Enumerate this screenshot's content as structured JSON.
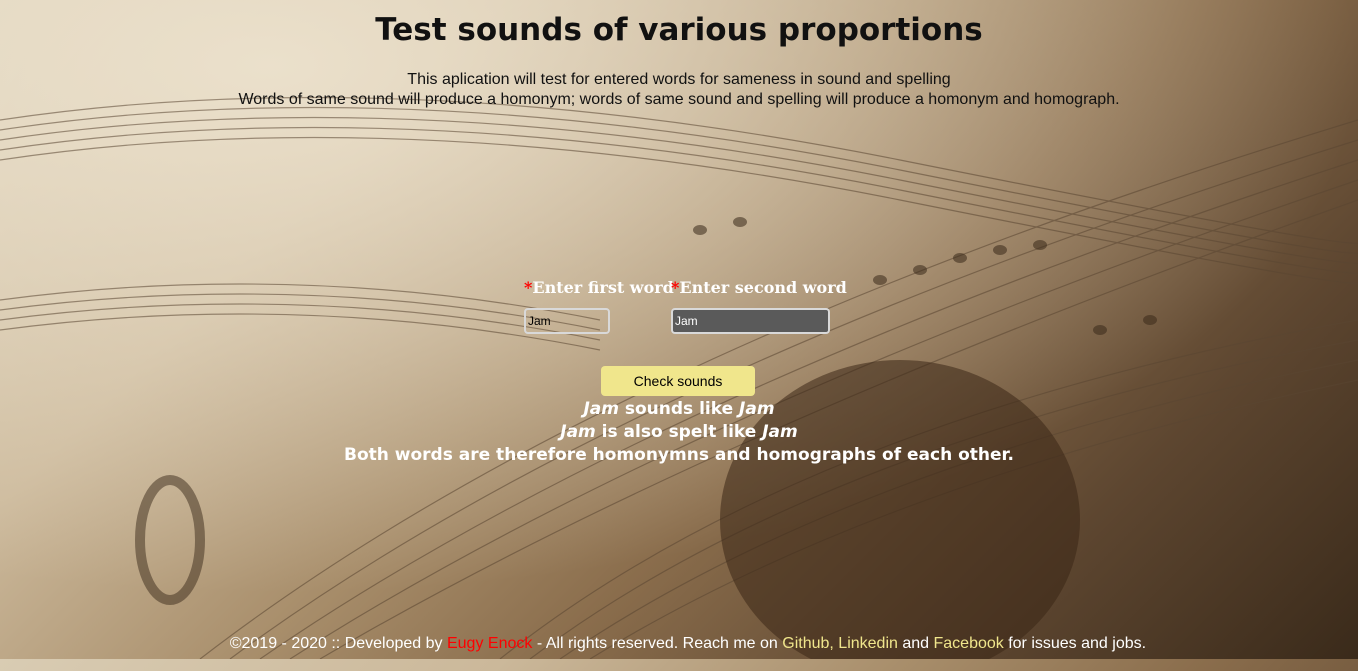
{
  "header": {
    "title": "Test sounds of various proportions",
    "intro_line1": "This aplication will test for entered words for sameness in sound and spelling",
    "intro_line2": "Words of same sound will produce a homonym; words of same sound and spelling will produce a homonym and homograph."
  },
  "form": {
    "required_marker": "*",
    "first_label": "Enter first word",
    "second_label": "Enter second word",
    "first_value": "Jam",
    "second_value": "Jam",
    "button_label": "Check sounds"
  },
  "result": {
    "word1": "Jam",
    "word2": "Jam",
    "sounds_like": " sounds like ",
    "also_spelt": " is also spelt like ",
    "conclusion": "Both words are therefore homonymns and homographs of each other."
  },
  "footer": {
    "prefix": "©2019 - 2020 :: Developed by ",
    "author": "Eugy Enock",
    "middle": " - All rights reserved. Reach me on ",
    "github": "Github",
    "comma": ", ",
    "linkedin": "Linkedin",
    "and": " and ",
    "facebook": "Facebook",
    "suffix": " for issues and jobs."
  },
  "colors": {
    "required": "#ff0000",
    "button": "#f0e68c",
    "link": "#f0e68c"
  }
}
